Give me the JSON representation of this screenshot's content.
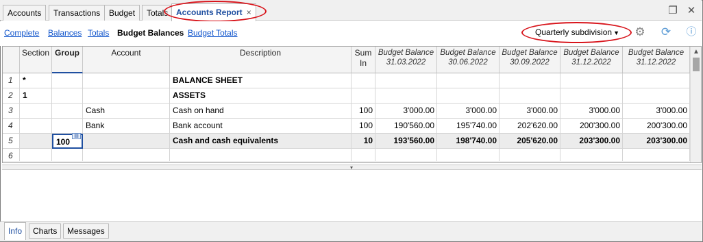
{
  "tabs": [
    "Accounts",
    "Transactions",
    "Budget",
    "Totals",
    "Accounts Report"
  ],
  "tab_close_glyph": "×",
  "view_links": [
    "Complete",
    "Balances",
    "Totals",
    "Budget Balances",
    "Budget Totals"
  ],
  "current_view": "Budget Balances",
  "subdivision": "Quarterly subdivision",
  "columns": {
    "section": "Section",
    "group": "Group",
    "account": "Account",
    "description": "Description",
    "sumin_1": "Sum",
    "sumin_2": "In",
    "budget_label": "Budget Balance",
    "dates": [
      "31.03.2022",
      "30.06.2022",
      "30.09.2022",
      "31.12.2022",
      "31.12.2022"
    ]
  },
  "rows": [
    {
      "num": "1",
      "section": "*",
      "group": "",
      "account": "",
      "description": "BALANCE SHEET",
      "sumin": "",
      "values": [
        "",
        "",
        "",
        "",
        ""
      ]
    },
    {
      "num": "2",
      "section": "1",
      "group": "",
      "account": "",
      "description": "ASSETS",
      "sumin": "",
      "values": [
        "",
        "",
        "",
        "",
        ""
      ]
    },
    {
      "num": "3",
      "section": "",
      "group": "",
      "account": "Cash",
      "description": "Cash on hand",
      "sumin": "100",
      "values": [
        "3'000.00",
        "3'000.00",
        "3'000.00",
        "3'000.00",
        "3'000.00"
      ]
    },
    {
      "num": "4",
      "section": "",
      "group": "",
      "account": "Bank",
      "description": "Bank account",
      "sumin": "100",
      "values": [
        "190'560.00",
        "195'740.00",
        "202'620.00",
        "200'300.00",
        "200'300.00"
      ]
    },
    {
      "num": "5",
      "section": "",
      "group": "100",
      "account": "",
      "description": "Cash and cash equivalents",
      "sumin": "10",
      "values": [
        "193'560.00",
        "198'740.00",
        "205'620.00",
        "203'300.00",
        "203'300.00"
      ]
    },
    {
      "num": "6",
      "section": "",
      "group": "",
      "account": "",
      "description": "",
      "sumin": "",
      "values": [
        "",
        "",
        "",
        "",
        ""
      ]
    }
  ],
  "bottom_tabs": [
    "Info",
    "Charts",
    "Messages"
  ],
  "colors": {
    "accent": "#1f4fa0",
    "link": "#1155cc",
    "highlight_ellipse": "#d8141b"
  }
}
